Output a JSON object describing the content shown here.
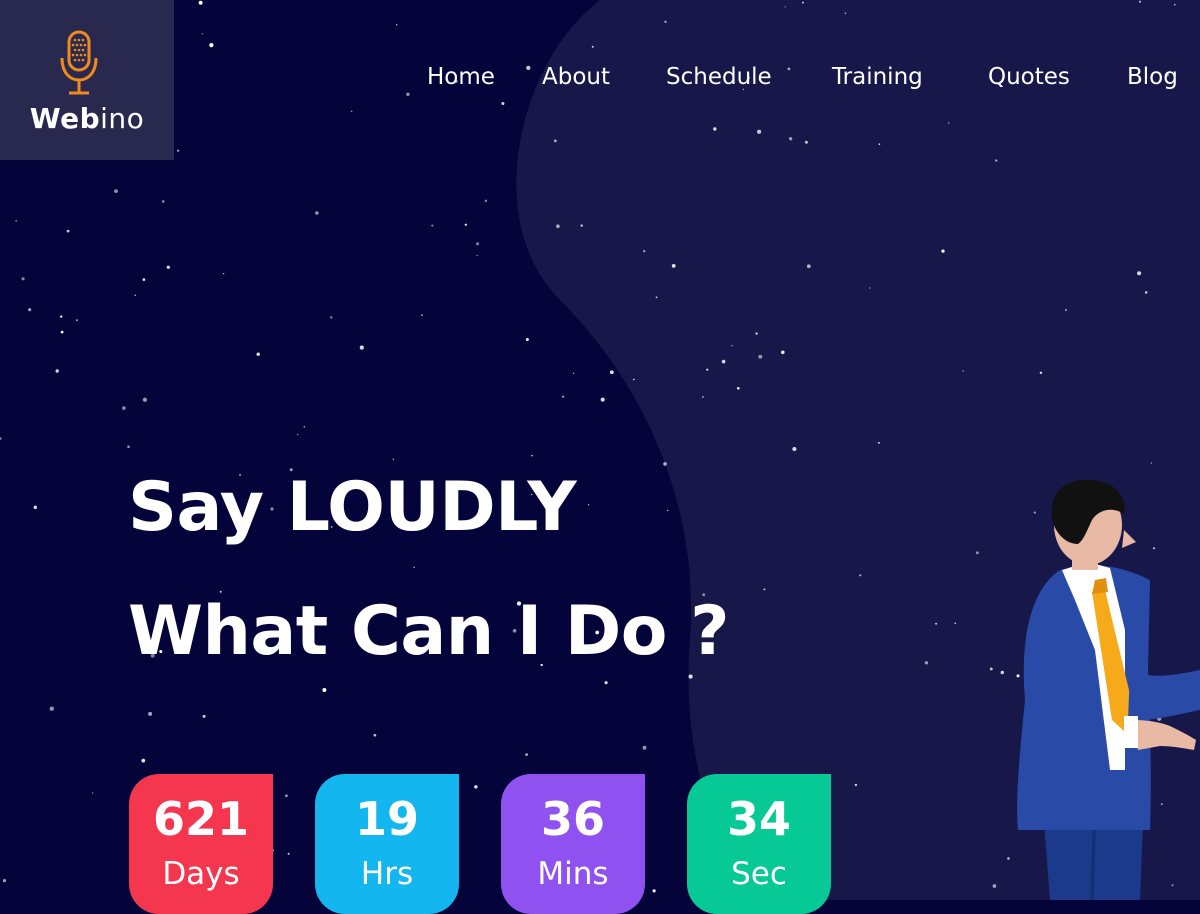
{
  "brand": {
    "name_bold": "Web",
    "name_light": "ino"
  },
  "nav": {
    "items": [
      {
        "label": "Home"
      },
      {
        "label": "About"
      },
      {
        "label": "Schedule"
      },
      {
        "label": "Training"
      },
      {
        "label": "Quotes"
      },
      {
        "label": "Blog"
      }
    ]
  },
  "hero": {
    "line1": "Say LOUDLY",
    "line2": "What Can I Do ?"
  },
  "countdown": [
    {
      "value": "621",
      "unit": "Days",
      "color": "#f5364f"
    },
    {
      "value": "19",
      "unit": "Hrs",
      "color": "#14b6f0"
    },
    {
      "value": "36",
      "unit": "Mins",
      "color": "#8f52f0"
    },
    {
      "value": "34",
      "unit": "Sec",
      "color": "#06c995"
    }
  ],
  "colors": {
    "background": "#04033a",
    "blob": "#17174a",
    "logo_bg": "#29294f",
    "accent": "#f08a1d"
  }
}
